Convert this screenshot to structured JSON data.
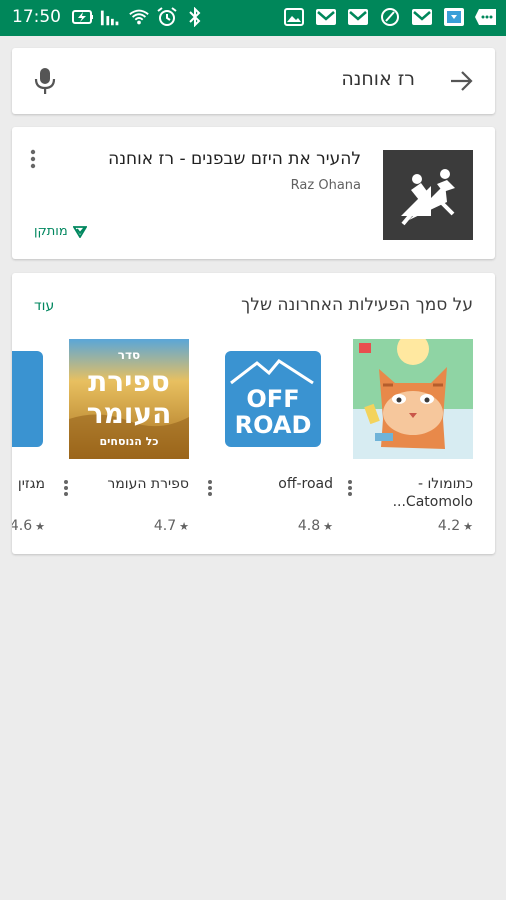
{
  "status_bar": {
    "time": "17:50",
    "icons": [
      "battery-charging-icon",
      "signal-bars-icon",
      "wifi-icon",
      "alarm-icon",
      "bluetooth-icon",
      "image-icon",
      "gmail-icon",
      "gmail-icon",
      "speed-icon",
      "gmail-icon",
      "shop-icon",
      "chat-icon"
    ]
  },
  "search": {
    "query": "רז אוחנה"
  },
  "app_card": {
    "title": "להעיר את היזם שבפנים - רז אוחנה",
    "developer": "Raz Ohana",
    "installed_label": "מותקן"
  },
  "recommendations": {
    "heading": "על סמך הפעילות האחרונה שלך",
    "more_label": "עוד",
    "apps": [
      {
        "name": "כתומולו - Catomolo...",
        "rating": "4.2"
      },
      {
        "name": "off-road",
        "rating": "4.8"
      },
      {
        "name": "ספירת העומר",
        "rating": "4.7"
      },
      {
        "name": "מגזין",
        "rating": "4.6"
      }
    ],
    "thumb_texts": {
      "offroad_1": "OFF",
      "offroad_2": "ROAD",
      "omer_top": "סדר",
      "omer_1": "ספירת",
      "omer_2": "העומר",
      "omer_bottom": "כל הנוסחים"
    }
  },
  "colors": {
    "accent": "#01875f",
    "status_bar": "#00875a"
  }
}
